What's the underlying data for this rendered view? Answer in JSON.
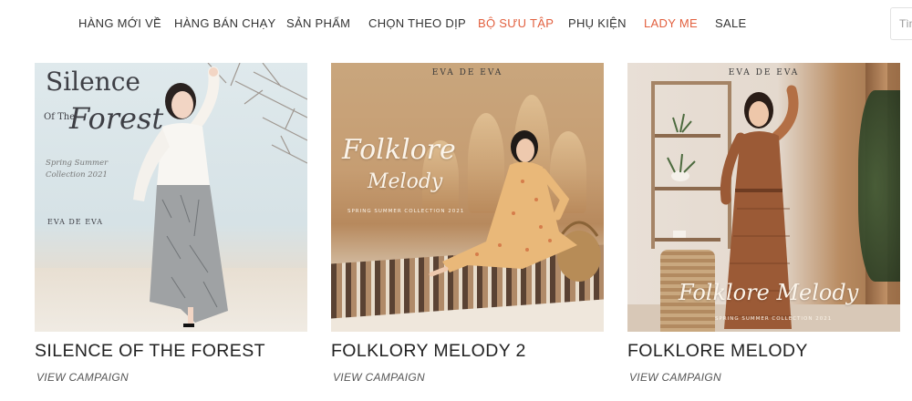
{
  "nav": {
    "items": [
      {
        "label": "HÀNG MỚI VỀ",
        "accent": false
      },
      {
        "label": "HÀNG BÁN CHẠY",
        "accent": false
      },
      {
        "label": "SẢN PHẨM",
        "accent": false
      },
      {
        "label": "CHỌN THEO DỊP",
        "accent": false
      },
      {
        "label": "BỘ SƯU TẬP",
        "accent": true
      },
      {
        "label": "PHỤ KIỆN",
        "accent": false
      },
      {
        "label": "LADY ME",
        "accent": true
      },
      {
        "label": "SALE",
        "accent": false
      }
    ],
    "search_placeholder": "Tìm"
  },
  "colors": {
    "accent": "#e2603f",
    "text": "#333333"
  },
  "campaigns": [
    {
      "title": "SILENCE OF THE FOREST",
      "link": "VIEW CAMPAIGN",
      "image_text": {
        "line1": "Silence",
        "of_the": "Of The",
        "forest": "Forest",
        "meta": "Spring Summer Collection 2021",
        "logo": "EVA DE EVA"
      }
    },
    {
      "title": "FOLKLORY MELODY 2",
      "link": "VIEW CAMPAIGN",
      "image_text": {
        "logo": "EVA DE EVA",
        "script1": "Folklore",
        "script2": "Melody",
        "subline": "SPRING SUMMER COLLECTION 2021"
      }
    },
    {
      "title": "FOLKLORE MELODY",
      "link": "VIEW CAMPAIGN",
      "image_text": {
        "logo": "EVA DE EVA",
        "script": "Folklore Melody",
        "subline": "SPRING SUMMER COLLECTION 2021"
      }
    }
  ]
}
